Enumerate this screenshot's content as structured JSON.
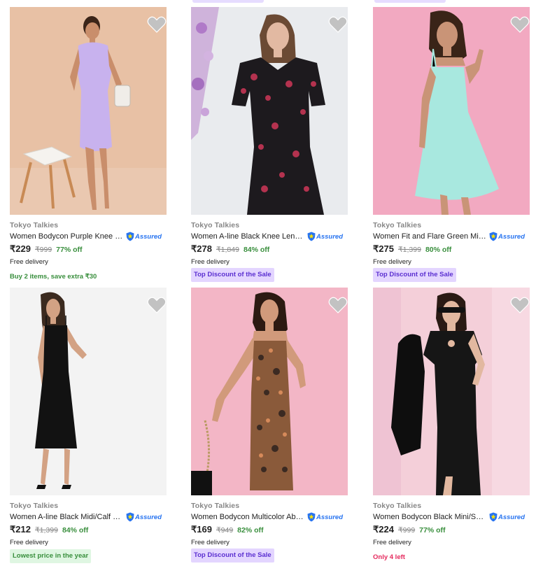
{
  "colors": {
    "price_green": "#388e3c",
    "assured_blue": "#2874f0",
    "tag_purple_bg": "#e3d5ff",
    "tag_purple_text": "#5b2fd1",
    "tag_green_bg": "#dff6e2",
    "urgency_red": "#e52a5e"
  },
  "assured_label": "Assured",
  "products": [
    {
      "brand": "Tokyo Talkies",
      "title": "Women Bodycon Purple Knee Le...",
      "price": "₹229",
      "mrp": "₹999",
      "discount": "77% off",
      "delivery": "Free delivery",
      "tag": "Buy 2 items, save extra ₹30",
      "image": "purple-bodycon-dress-photo"
    },
    {
      "brand": "Tokyo Talkies",
      "title": "Women A-line Black Knee Lengt...",
      "price": "₹278",
      "mrp": "₹1,849",
      "discount": "84% off",
      "delivery": "Free delivery",
      "tag": "Top Discount of the Sale",
      "image": "black-floral-aline-dress-photo"
    },
    {
      "brand": "Tokyo Talkies",
      "title": "Women Fit and Flare Green Mini/...",
      "price": "₹275",
      "mrp": "₹1,399",
      "discount": "80% off",
      "delivery": "Free delivery",
      "tag": "Top Discount of the Sale",
      "image": "mint-green-fit-flare-dress-photo"
    },
    {
      "brand": "Tokyo Talkies",
      "title": "Women A-line Black Midi/Calf Le...",
      "price": "₹212",
      "mrp": "₹1,399",
      "discount": "84% off",
      "delivery": "Free delivery",
      "tag": "Lowest price in the year",
      "image": "black-velvet-midi-dress-photo"
    },
    {
      "brand": "Tokyo Talkies",
      "title": "Women Bodycon Multicolor Abo...",
      "price": "₹169",
      "mrp": "₹949",
      "discount": "82% off",
      "delivery": "Free delivery",
      "tag": "Top Discount of the Sale",
      "image": "multicolor-print-bodycon-dress-photo"
    },
    {
      "brand": "Tokyo Talkies",
      "title": "Women Bodycon Black Mini/Sho...",
      "price": "₹224",
      "mrp": "₹999",
      "discount": "77% off",
      "delivery": "Free delivery",
      "tag": "Only 4 left",
      "image": "black-bodycon-mini-dress-photo"
    }
  ]
}
